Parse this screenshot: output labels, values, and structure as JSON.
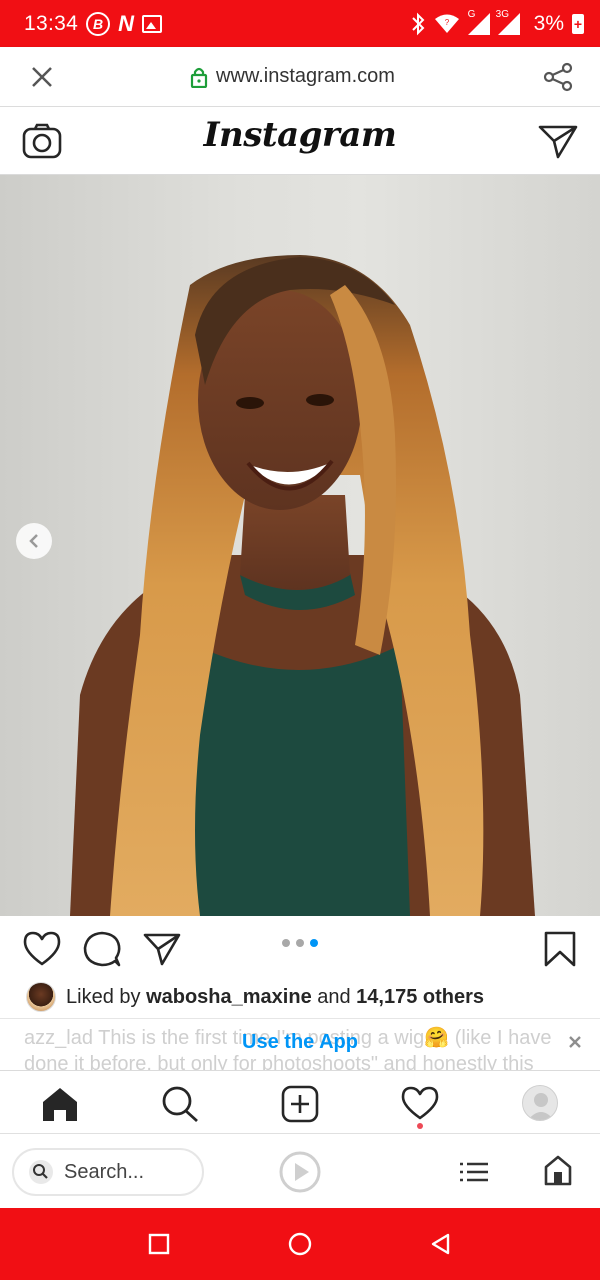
{
  "status_bar": {
    "time": "13:34",
    "badge_b": "B",
    "badge_n": "N",
    "network_g": "G",
    "network_3g": "3G",
    "battery": "3%",
    "battery_plus": "+",
    "bg_color": "#f10f14"
  },
  "url_bar": {
    "url": "www.instagram.com",
    "close_icon": "close-icon",
    "lock_icon": "lock-icon",
    "share_icon": "share-icon"
  },
  "instagram": {
    "logo": "Instagram",
    "camera_icon": "camera-icon",
    "direct_icon": "paper-plane-icon"
  },
  "post": {
    "carousel_total": 3,
    "carousel_active": 3,
    "liked_by_prefix": "Liked by ",
    "liked_by_user": "wabosha_maxine",
    "liked_by_middle": " and ",
    "liked_by_count": "14,175 others",
    "caption_faded": "azz_lad This is the first time I'm posting a wig🤗 (like I have done it before, but only for photoshoots\" and honestly this",
    "use_app": "Use the App"
  },
  "ig_nav": {
    "items": [
      "home-icon",
      "search-icon",
      "new-post-icon",
      "activity-heart-icon",
      "profile-avatar"
    ]
  },
  "browser_bar": {
    "search_placeholder": "Search...",
    "icons": [
      "search-icon",
      "play-icon",
      "list-icon",
      "home-icon"
    ]
  },
  "android_nav": {
    "icons": [
      "recents-square-icon",
      "home-circle-icon",
      "back-triangle-icon"
    ],
    "bg_color": "#f10f14"
  },
  "colors": {
    "accent_blue": "#0095f6",
    "heart_red": "#ed4956",
    "text_dark": "#262626"
  }
}
